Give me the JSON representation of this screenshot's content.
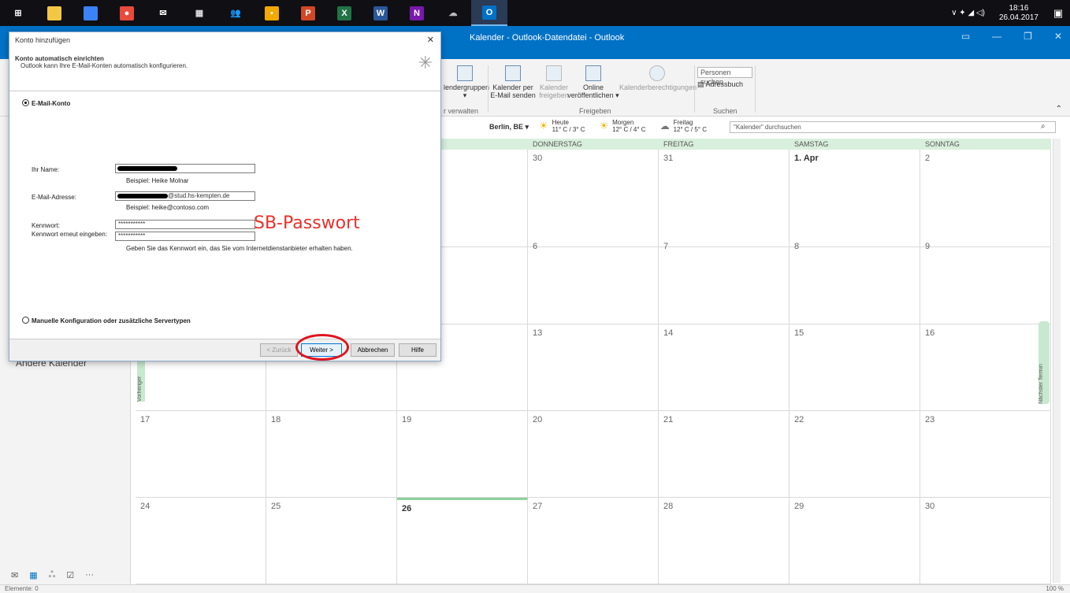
{
  "taskbar": {
    "icons": [
      {
        "name": "start",
        "color": "#ffffff",
        "glyph": "⊞"
      },
      {
        "name": "explorer",
        "color": "#f2c744",
        "glyph": ""
      },
      {
        "name": "app",
        "color": "#3b82f6",
        "glyph": ""
      },
      {
        "name": "chrome",
        "color": "#e84b3c",
        "glyph": "●"
      },
      {
        "name": "mail",
        "color": "#ffffff",
        "glyph": "✉"
      },
      {
        "name": "calendar",
        "color": "#dddddd",
        "glyph": "▦"
      },
      {
        "name": "people",
        "color": "#ffffff",
        "glyph": "👥"
      },
      {
        "name": "app2",
        "color": "#f2a900",
        "glyph": "▪"
      },
      {
        "name": "powerpoint",
        "color": "#d24726",
        "glyph": "P"
      },
      {
        "name": "excel",
        "color": "#217346",
        "glyph": "X"
      },
      {
        "name": "word",
        "color": "#2b579a",
        "glyph": "W"
      },
      {
        "name": "onenote",
        "color": "#7719aa",
        "glyph": "N"
      },
      {
        "name": "other",
        "color": "#bbbbbb",
        "glyph": "☁"
      },
      {
        "name": "outlook",
        "color": "#0072c6",
        "glyph": "O"
      }
    ],
    "time": "18:16",
    "date": "26.04.2017"
  },
  "window": {
    "title": "Kalender - Outlook-Datendatei  -  Outlook"
  },
  "ribbon": {
    "items": [
      {
        "label": "lendergruppen"
      },
      {
        "label": "Kalender per\nE-Mail senden"
      },
      {
        "label": "Kalender\nfreigeben"
      },
      {
        "label": "Online\nveröffentlichen ▾"
      },
      {
        "label": "Kalenderberechtigungen"
      }
    ],
    "group_labels": {
      "manage": "r verwalten",
      "share": "Freigeben",
      "find": "Suchen"
    },
    "search_people": "Personen suchen",
    "addressbook": "Adressbuch"
  },
  "weather": {
    "location": "Berlin, BE ▾",
    "days": [
      {
        "label": "Heute",
        "temp": "11° C / 3° C"
      },
      {
        "label": "Morgen",
        "temp": "12° C / 4° C"
      },
      {
        "label": "Freitag",
        "temp": "12° C / 5° C"
      }
    ],
    "search_placeholder": "\"Kalender\" durchsuchen"
  },
  "calendar": {
    "day_headers": [
      "DONNERSTAG",
      "FREITAG",
      "SAMSTAG",
      "SONNTAG"
    ],
    "weeks": [
      [
        "",
        "",
        "",
        "30",
        "31",
        "1. Apr",
        "2"
      ],
      [
        "",
        "",
        "",
        "6",
        "7",
        "8",
        "9"
      ],
      [
        "",
        "",
        "",
        "13",
        "14",
        "15",
        "16"
      ],
      [
        "17",
        "18",
        "19",
        "20",
        "21",
        "22",
        "23"
      ],
      [
        "24",
        "25",
        "26",
        "27",
        "28",
        "29",
        "30"
      ]
    ],
    "today": "26",
    "prev_tab": "Vorheriger",
    "next_tab": "Nächster Termin"
  },
  "sidebar": {
    "other_calendars": "Andere Kalender",
    "nav_more": "···"
  },
  "status": {
    "items": "Elemente: 0",
    "zoom": "100 %"
  },
  "dialog": {
    "title": "Konto hinzufügen",
    "close": "✕",
    "header_title": "Konto automatisch einrichten",
    "header_sub": "Outlook kann Ihre E-Mail-Konten automatisch konfigurieren.",
    "radio_email": "E-Mail-Konto",
    "name_label": "Ihr Name:",
    "name_example": "Beispiel: Heike Molnar",
    "email_label": "E-Mail-Adresse:",
    "email_value": "@stud.hs-kempten.de",
    "email_example": "Beispiel: heike@contoso.com",
    "pw_label": "Kennwort:",
    "pw_value": "***********",
    "pw2_label": "Kennwort erneut eingeben:",
    "pw2_value": "***********",
    "pw_hint": "Geben Sie das Kennwort ein, das Sie vom Internetdienstanbieter erhalten haben.",
    "annotation": "SB-Passwort",
    "radio_manual": "Manuelle Konfiguration oder zusätzliche Servertypen",
    "btn_back": "< Zurück",
    "btn_next": "Weiter >",
    "btn_cancel": "Abbrechen",
    "btn_help": "Hilfe"
  }
}
